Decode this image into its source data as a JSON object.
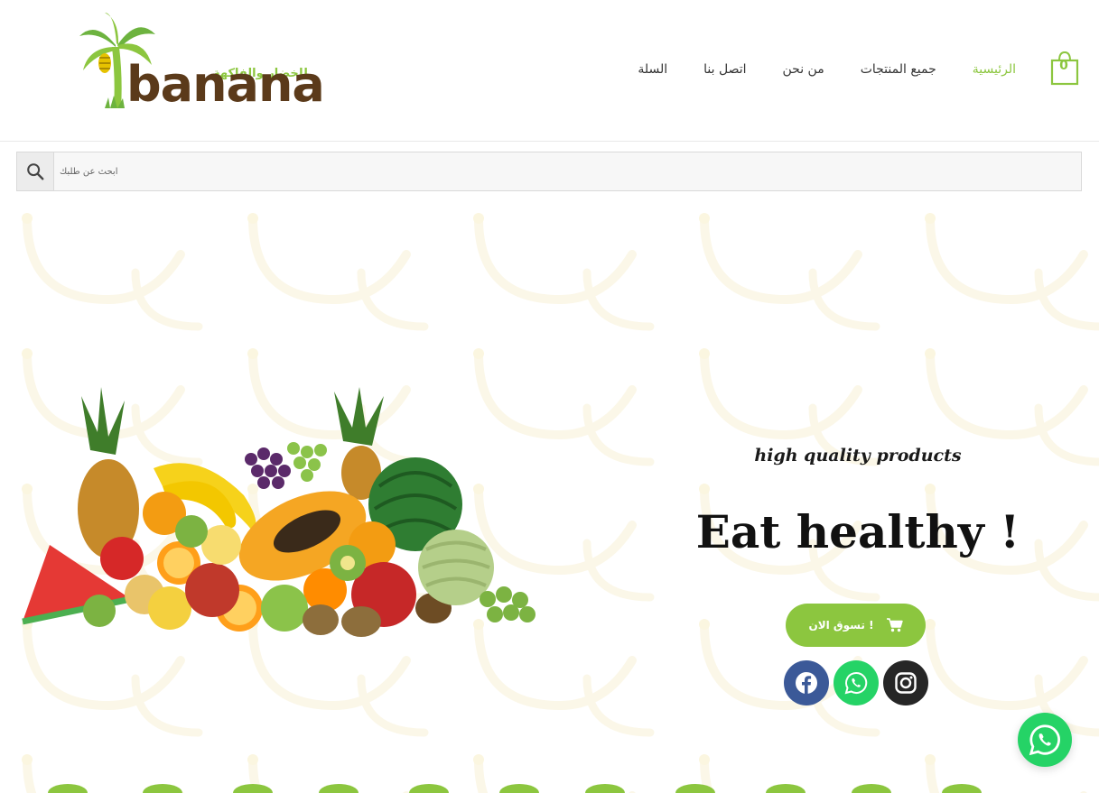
{
  "header": {
    "logo": {
      "brand": "banana",
      "tagline": "للخضار والفاكهة"
    },
    "nav": [
      {
        "label": "الرئيسية",
        "active": true
      },
      {
        "label": "جميع المنتجات",
        "active": false
      },
      {
        "label": "من نحن",
        "active": false
      },
      {
        "label": "اتصل بنا",
        "active": false
      },
      {
        "label": "السلة",
        "active": false
      }
    ],
    "cart": {
      "count": "0",
      "icon": "shopping-bag-icon"
    }
  },
  "search": {
    "placeholder": "ابحث عن طلبك",
    "icon": "search-icon"
  },
  "hero": {
    "tagline": "high quality products",
    "headline": "Eat healthy !",
    "cta_label": "تسوق الان !",
    "cta_icon": "cart-icon",
    "image": "fruit-assortment-image"
  },
  "social": [
    {
      "name": "facebook",
      "icon": "facebook-icon",
      "color": "#3b5998"
    },
    {
      "name": "whatsapp",
      "icon": "whatsapp-icon",
      "color": "#25d366"
    },
    {
      "name": "instagram",
      "icon": "instagram-icon",
      "color": "#262626"
    }
  ],
  "colors": {
    "accent": "#8cc63f",
    "brand_brown": "#5b3a1a",
    "whatsapp": "#25d366"
  }
}
